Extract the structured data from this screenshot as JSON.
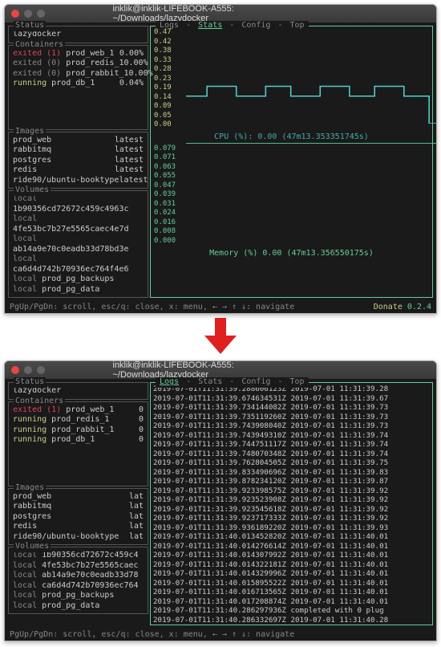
{
  "window_title": "inklik@inklik-LIFEBOOK-A555: ~/Downloads/lazydocker",
  "status_label": "Status",
  "containers_label": "Containers",
  "images_label": "Images",
  "volumes_label": "Volumes",
  "status_value": "lazydocker",
  "top_window": {
    "containers": [
      {
        "state": "exited (1)",
        "state_cls": "red",
        "name": "prod_web_1",
        "pct": "0.00%"
      },
      {
        "state": "exited (0)",
        "state_cls": "muted",
        "name": "prod_redis_1",
        "pct": "0.00%"
      },
      {
        "state": "exited (0)",
        "state_cls": "muted",
        "name": "prod_rabbit_1",
        "pct": "0.00%"
      },
      {
        "state": "running",
        "state_cls": "yellow",
        "name": "prod_db_1",
        "pct": "0.04%"
      }
    ],
    "images": [
      {
        "name": "prod_web",
        "tag": "latest"
      },
      {
        "name": "rabbitmq",
        "tag": "latest"
      },
      {
        "name": "postgres",
        "tag": "latest"
      },
      {
        "name": "redis",
        "tag": "latest"
      },
      {
        "name": "ride90/ubuntu-booktype",
        "tag": "latest"
      }
    ],
    "volumes": [
      {
        "scope": "local",
        "name": "1b90356cd72672c459c4963c"
      },
      {
        "scope": "local",
        "name": "4fe53bc7b27e5565caec4e7d"
      },
      {
        "scope": "local",
        "name": "ab14a9e70c0eadb33d78bd3e"
      },
      {
        "scope": "local",
        "name": "ca6d4d742b70936ec764f4e6"
      },
      {
        "scope": "local",
        "name": "prod_pg_backups"
      },
      {
        "scope": "local",
        "name": "prod_pg_data"
      }
    ],
    "tabs": [
      "Logs",
      "Stats",
      "Config",
      "Top"
    ],
    "active_tab": 1,
    "cpu_caption": "CPU (%): 0.00 (47m13.353351745s)",
    "mem_caption": "Memory (%)  0.00 (47m13.356550175s)"
  },
  "bottom_window": {
    "containers": [
      {
        "state": "exited (1)",
        "state_cls": "red",
        "name": "prod_web_1",
        "pct": "0"
      },
      {
        "state": "running",
        "state_cls": "yellow",
        "name": "prod_redis_1",
        "pct": "0"
      },
      {
        "state": "running",
        "state_cls": "yellow",
        "name": "prod_rabbit_1",
        "pct": "0"
      },
      {
        "state": "running",
        "state_cls": "yellow",
        "name": "prod_db_1",
        "pct": "0"
      }
    ],
    "images": [
      {
        "name": "prod_web",
        "tag": "lat"
      },
      {
        "name": "rabbitmq",
        "tag": "lat"
      },
      {
        "name": "postgres",
        "tag": "lat"
      },
      {
        "name": "redis",
        "tag": "lat"
      },
      {
        "name": "ride90/ubuntu-booktype",
        "tag": "lat"
      }
    ],
    "volumes": [
      {
        "scope": "local",
        "name": "1b90356cd72672c459c4"
      },
      {
        "scope": "local",
        "name": "4fe53bc7b27e5565caec"
      },
      {
        "scope": "local",
        "name": "ab14a9e70c0eadb33d78"
      },
      {
        "scope": "local",
        "name": "ca6d4d742b70936ec764"
      },
      {
        "scope": "local",
        "name": "prod_pg_backups"
      },
      {
        "scope": "local",
        "name": "prod_pg_data"
      }
    ],
    "tabs": [
      "Logs",
      "Stats",
      "Config",
      "Top"
    ],
    "active_tab": 0,
    "log_lines": [
      "2019-07-01T11:31:39.288606123Z  2019-07-01 11:31:39.28",
      "2019-07-01T11:31:39.674634531Z  2019-07-01 11:31:39.67",
      "2019-07-01T11:31:39.734144082Z  2019-07-01 11:31:39.73",
      "2019-07-01T11:31:39.735119260Z  2019-07-01 11:31:39.73",
      "2019-07-01T11:31:39.743908040Z  2019-07-01 11:31:39.73",
      "2019-07-01T11:31:39.743949310Z  2019-07-01 11:31:39.74",
      "2019-07-01T11:31:39.744751117Z  2019-07-01 11:31:39.74",
      "2019-07-01T11:31:39.748070348Z  2019-07-01 11:31:39.74",
      "2019-07-01T11:31:39.762804505Z  2019-07-01 11:31:39.75",
      "2019-07-01T11:31:39.833490696Z  2019-07-01 11:31:39.83",
      "2019-07-01T11:31:39.878234120Z  2019-07-01 11:31:39.87",
      "2019-07-01T11:31:39.923398575Z  2019-07-01 11:31:39.92",
      "2019-07-01T11:31:39.923523908Z  2019-07-01 11:31:39.92",
      "2019-07-01T11:31:39.923545618Z  2019-07-01 11:31:39.92",
      "2019-07-01T11:31:39.923717333Z  2019-07-01 11:31:39.92",
      "2019-07-01T11:31:39.936189220Z  2019-07-01 11:31:39.93",
      "2019-07-01T11:31:40.013452820Z  2019-07-01 11:31:40.01",
      "2019-07-01T11:31:40.014276614Z  2019-07-01 11:31:40.01",
      "2019-07-01T11:31:40.014307992Z  2019-07-01 11:31:40.01",
      "2019-07-01T11:31:40.014322181Z  2019-07-01 11:31:40.01",
      "2019-07-01T11:31:40.014329996Z  2019-07-01 11:31:40.01",
      "2019-07-01T11:31:40.015895522Z  2019-07-01 11:31:40.01",
      "2019-07-01T11:31:40.016713565Z  2019-07-01 11:31:40.01",
      "2019-07-01T11:31:40.017208874Z  2019-07-01 11:31:40.01",
      "2019-07-01T11:31:40.286297936Z  completed with 0 plug",
      "2019-07-01T11:31:40.286332697Z  2019-07-01 11:31:40.28"
    ]
  },
  "chart_data": [
    {
      "type": "line",
      "name": "cpu",
      "y_ticks": [
        "0.47",
        "0.42",
        "0.38",
        "0.33",
        "0.28",
        "0.23",
        "0.19",
        "0.14",
        "0.09",
        "0.05",
        "0.00"
      ],
      "ylim": [
        0,
        0.47
      ],
      "xlabel": "",
      "ylabel": "CPU (%)",
      "title": "CPU (%): 0.00 (47m13.353351745s)",
      "path_points": [
        [
          0,
          0.14
        ],
        [
          25,
          0.14
        ],
        [
          25,
          0.19
        ],
        [
          60,
          0.19
        ],
        [
          60,
          0.14
        ],
        [
          95,
          0.14
        ],
        [
          95,
          0.19
        ],
        [
          125,
          0.19
        ],
        [
          125,
          0.14
        ],
        [
          160,
          0.14
        ],
        [
          160,
          0.19
        ],
        [
          195,
          0.19
        ],
        [
          195,
          0.14
        ],
        [
          225,
          0.14
        ],
        [
          225,
          0.19
        ],
        [
          260,
          0.19
        ],
        [
          260,
          0.14
        ],
        [
          290,
          0.14
        ],
        [
          290,
          0.0
        ],
        [
          300,
          0.0
        ]
      ]
    },
    {
      "type": "line",
      "name": "memory",
      "y_ticks": [
        "0.079",
        "0.071",
        "0.063",
        "0.055",
        "0.047",
        "0.039",
        "0.031",
        "0.024",
        "0.016",
        "0.008",
        "0.000"
      ],
      "ylim": [
        0,
        0.079
      ],
      "xlabel": "",
      "ylabel": "Memory (%)",
      "title": "Memory (%)  0.00 (47m13.356550175s)",
      "path_points": [
        [
          0,
          0.079
        ],
        [
          280,
          0.079
        ],
        [
          280,
          0.0
        ],
        [
          300,
          0.0
        ]
      ]
    }
  ],
  "footer_text": "PgUp/PgDn: scroll, esc/q: close, x: menu, ← → ↑ ↓: navigate",
  "donate_text": "Donate",
  "version_text": "0.2.4"
}
